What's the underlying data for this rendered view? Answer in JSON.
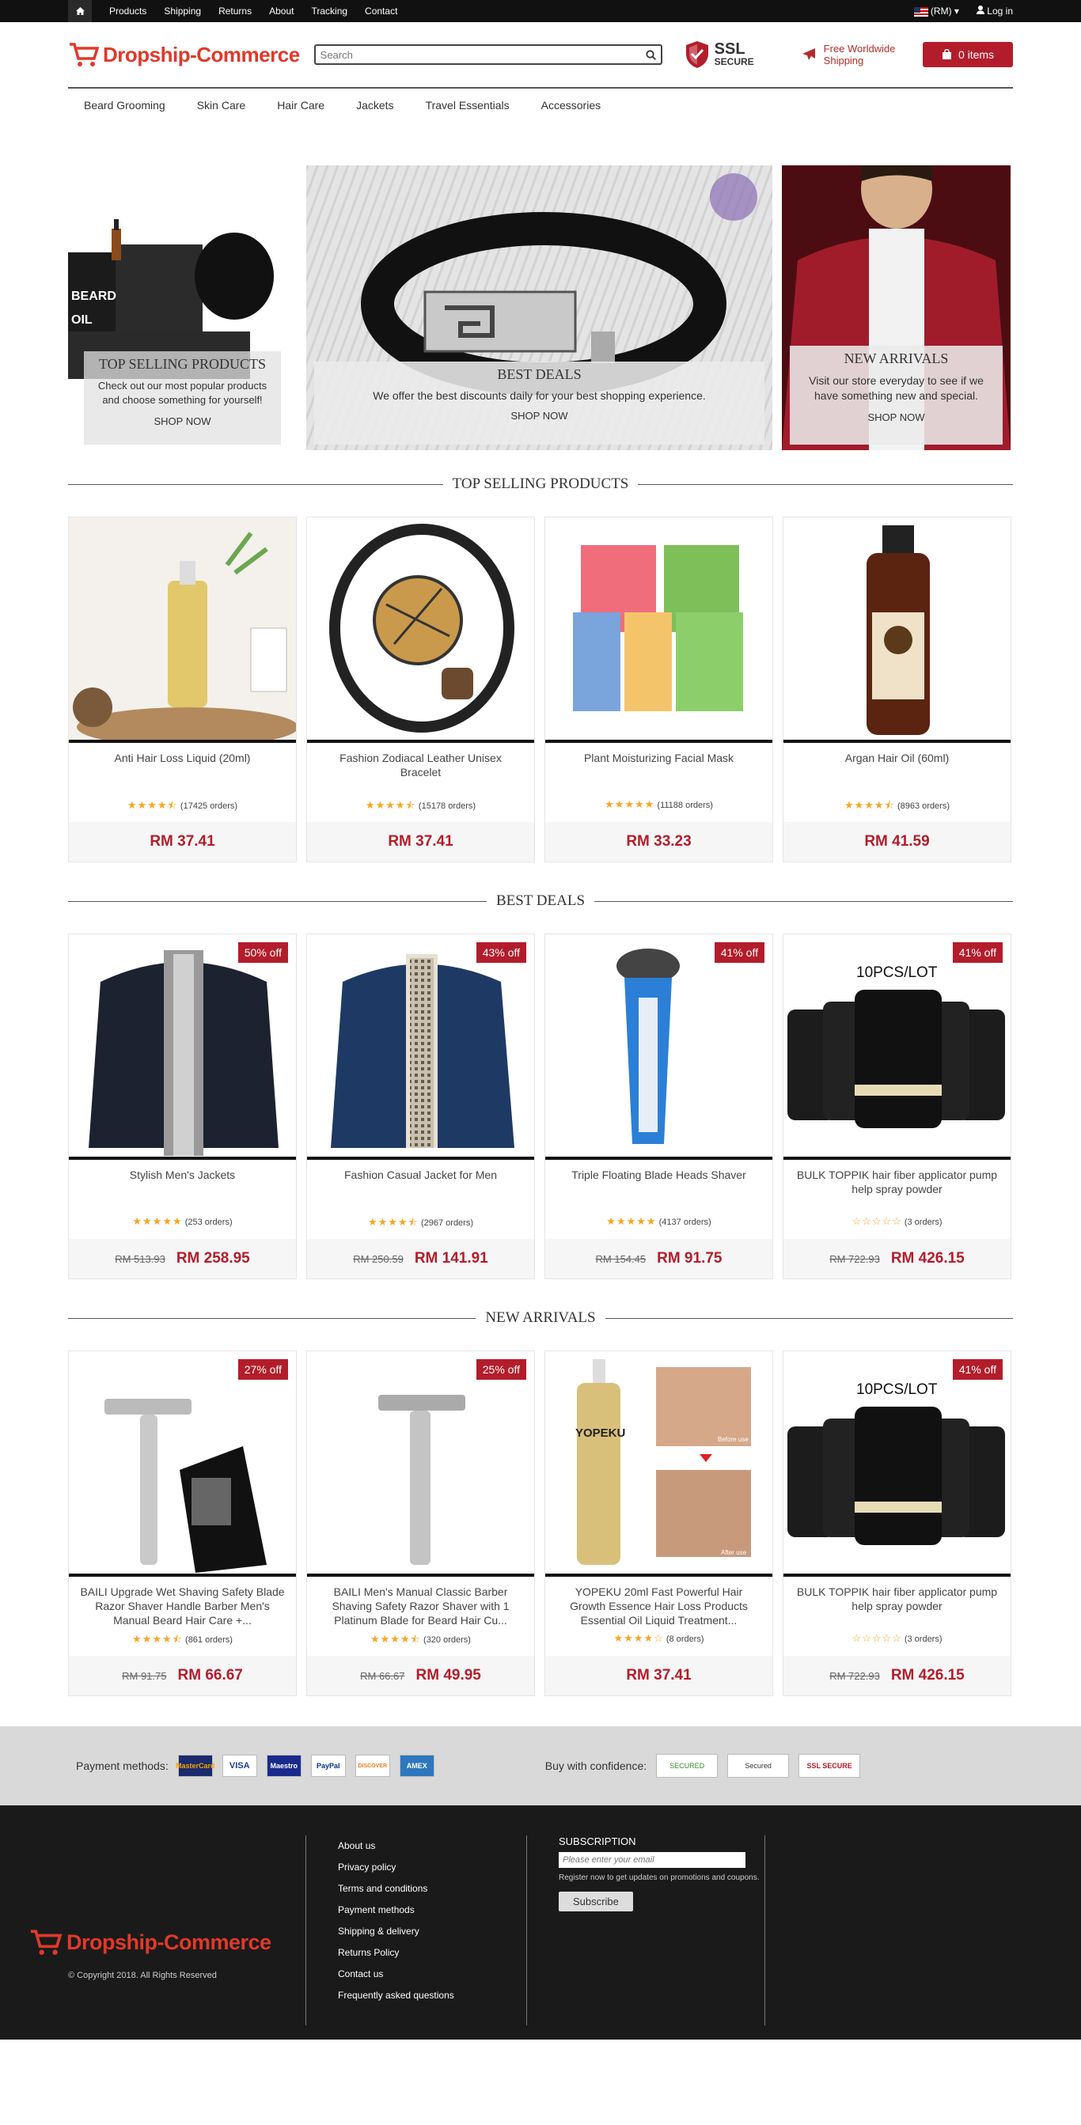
{
  "topbar": {
    "nav": [
      "Products",
      "Shipping",
      "Returns",
      "About",
      "Tracking",
      "Contact"
    ],
    "currency": "(RM)",
    "login": "Log in"
  },
  "header": {
    "logo": "Dropship-Commerce",
    "search_placeholder": "Search",
    "ssl_big": "SSL",
    "ssl_small": "SECURE",
    "shipping_line1": "Free Worldwide",
    "shipping_line2": "Shipping",
    "cart": "0 items"
  },
  "menu": [
    "Beard Grooming",
    "Skin Care",
    "Hair Care",
    "Jackets",
    "Travel Essentials",
    "Accessories"
  ],
  "hero": [
    {
      "title": "TOP SELLING PRODUCTS",
      "text": "Check out our most popular products and choose something for yourself!",
      "link": "SHOP NOW"
    },
    {
      "title": "BEST DEALS",
      "text": "We offer the best discounts daily for your best shopping experience.",
      "link": "SHOP NOW"
    },
    {
      "title": "NEW ARRIVALS",
      "text": "Visit our store everyday to see if we have something new and special.",
      "link": "SHOP NOW"
    }
  ],
  "sections": {
    "top": "TOP SELLING PRODUCTS",
    "deals": "BEST DEALS",
    "arrivals": "NEW ARRIVALS"
  },
  "top_products": [
    {
      "name": "Anti Hair Loss Liquid (20ml)",
      "stars": "★★★★⯪",
      "orders": "(17425 orders)",
      "price": "RM 37.41"
    },
    {
      "name": "Fashion Zodiacal Leather Unisex Bracelet",
      "stars": "★★★★⯪",
      "orders": "(15178 orders)",
      "price": "RM 37.41"
    },
    {
      "name": "Plant Moisturizing Facial Mask",
      "stars": "★★★★★",
      "orders": "(11188 orders)",
      "price": "RM 33.23"
    },
    {
      "name": "Argan Hair Oil (60ml)",
      "stars": "★★★★⯪",
      "orders": "(8963 orders)",
      "price": "RM 41.59"
    }
  ],
  "deal_products": [
    {
      "badge": "50% off",
      "name": "Stylish Men's Jackets",
      "stars": "★★★★★",
      "orders": "(253 orders)",
      "old": "RM 513.93",
      "price": "RM 258.95"
    },
    {
      "badge": "43% off",
      "name": "Fashion Casual Jacket for Men",
      "stars": "★★★★⯪",
      "orders": "(2967 orders)",
      "old": "RM 250.59",
      "price": "RM 141.91"
    },
    {
      "badge": "41% off",
      "name": "Triple Floating Blade Heads Shaver",
      "stars": "★★★★★",
      "orders": "(4137 orders)",
      "old": "RM 154.45",
      "price": "RM 91.75"
    },
    {
      "badge": "41% off",
      "name": "BULK TOPPIK hair fiber applicator pump help spray powder",
      "stars": "☆☆☆☆☆",
      "orders": "(3 orders)",
      "old": "RM 722.93",
      "price": "RM 426.15",
      "lot": "10PCS/LOT"
    }
  ],
  "new_products": [
    {
      "badge": "27% off",
      "name": "BAILI Upgrade Wet Shaving Safety Blade Razor Shaver Handle Barber Men's Manual Beard Hair Care +...",
      "stars": "★★★★⯪",
      "orders": "(861 orders)",
      "old": "RM 91.75",
      "price": "RM 66.67"
    },
    {
      "badge": "25% off",
      "name": "BAILI Men's Manual Classic Barber Shaving Safety Razor Shaver with 1 Platinum Blade for Beard Hair Cu...",
      "stars": "★★★★⯪",
      "orders": "(320 orders)",
      "old": "RM 66.67",
      "price": "RM 49.95"
    },
    {
      "name": "YOPEKU 20ml Fast Powerful Hair Growth Essence Hair Loss Products Essential Oil Liquid Treatment...",
      "stars": "★★★★☆",
      "orders": "(8 orders)",
      "price": "RM 37.41",
      "label1": "Before use",
      "label2": "After use",
      "bottle": "YOPEKU"
    },
    {
      "badge": "41% off",
      "name": "BULK TOPPIK hair fiber applicator pump help spray powder",
      "stars": "☆☆☆☆☆",
      "orders": "(3 orders)",
      "old": "RM 722.93",
      "price": "RM 426.15",
      "lot": "10PCS/LOT"
    }
  ],
  "payments": {
    "label": "Payment methods:",
    "cards": [
      "MasterCard",
      "VISA",
      "Maestro",
      "PayPal",
      "DISCOVER",
      "AMEX"
    ],
    "trust_label": "Buy with confidence:",
    "trust": [
      "SECURED",
      "Secured",
      "SSL SECURE"
    ]
  },
  "footer": {
    "logo": "Dropship-Commerce",
    "copyright": "© Copyright 2018. All Rights Reserved",
    "links": [
      "About us",
      "Privacy policy",
      "Terms and conditions",
      "Payment methods",
      "Shipping & delivery",
      "Returns Policy",
      "Contact us",
      "Frequently asked questions"
    ],
    "subscription_title": "SUBSCRIPTION",
    "email_placeholder": "Please enter your email",
    "subscription_note": "Register now to get updates on promotions and coupons.",
    "subscribe_button": "Subscribe"
  }
}
